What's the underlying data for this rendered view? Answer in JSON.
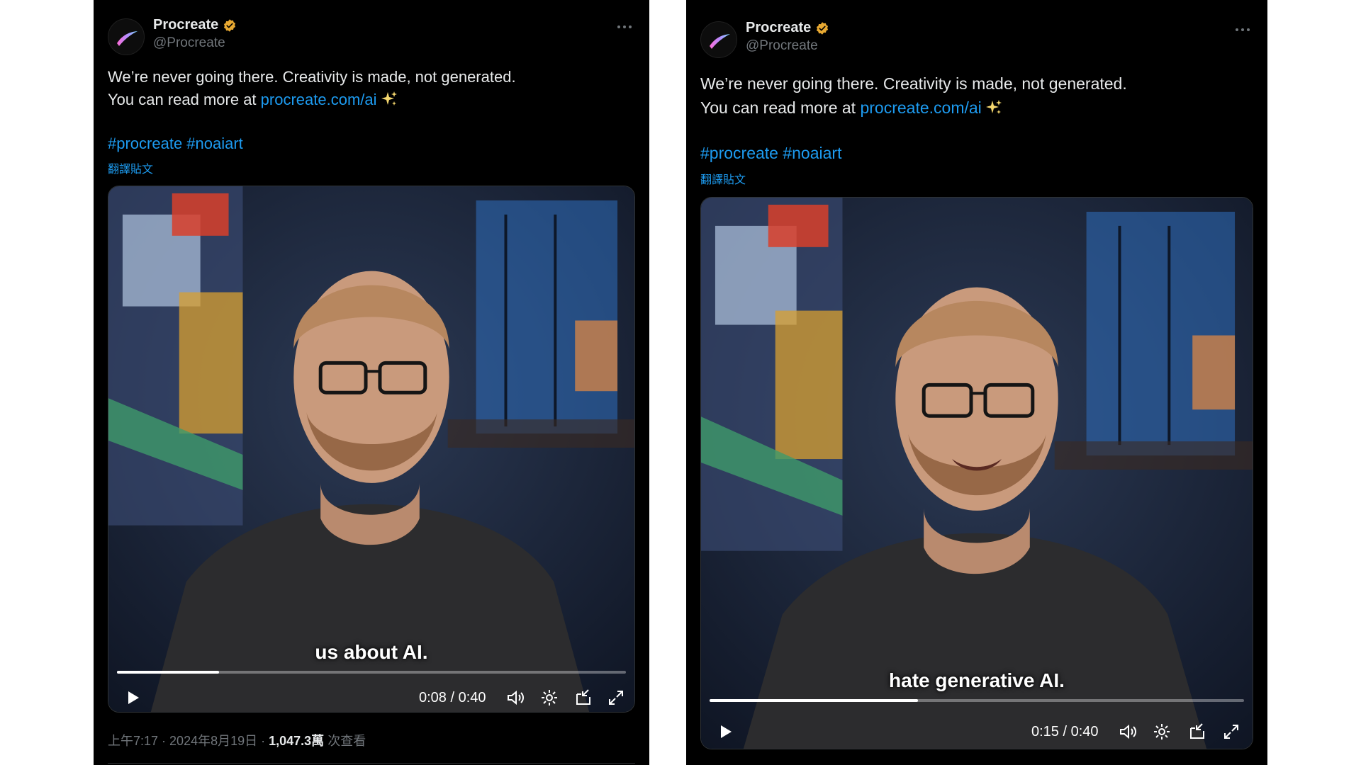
{
  "posts": [
    {
      "author": {
        "name": "Procreate",
        "handle": "@Procreate",
        "verified_badge": "verified-badge-gold"
      },
      "text_line1": "We’re never going there. Creativity is made, not generated.",
      "text_line2_prefix": "You can read more at ",
      "link": "procreate.com/ai",
      "emoji": "sparkles-emoji",
      "hashtags": "#procreate #noaiart",
      "translate_label": "翻譯貼文",
      "video": {
        "caption": "us about AI.",
        "current_time": "0:08",
        "separator": " / ",
        "duration": "0:40",
        "progress_fraction": 0.2
      },
      "meta": {
        "time": "上午7:17",
        "dot1": " · ",
        "date": "2024年8月19日",
        "dot2": " · ",
        "views": "1,047.3萬",
        "views_label": " 次查看"
      }
    },
    {
      "author": {
        "name": "Procreate",
        "handle": "@Procreate",
        "verified_badge": "verified-badge-gold"
      },
      "text_line1": "We’re never going there. Creativity is made, not generated.",
      "text_line2_prefix": "You can read more at ",
      "link": "procreate.com/ai",
      "emoji": "sparkles-emoji",
      "hashtags": "#procreate #noaiart",
      "translate_label": "翻譯貼文",
      "video": {
        "caption": "hate generative AI.",
        "current_time": "0:15",
        "separator": " / ",
        "duration": "0:40",
        "progress_fraction": 0.39
      }
    }
  ],
  "colors": {
    "background": "#000000",
    "text": "#e7e9ea",
    "muted": "#71767b",
    "link": "#1d9bf0",
    "badge": "#e8a932"
  }
}
